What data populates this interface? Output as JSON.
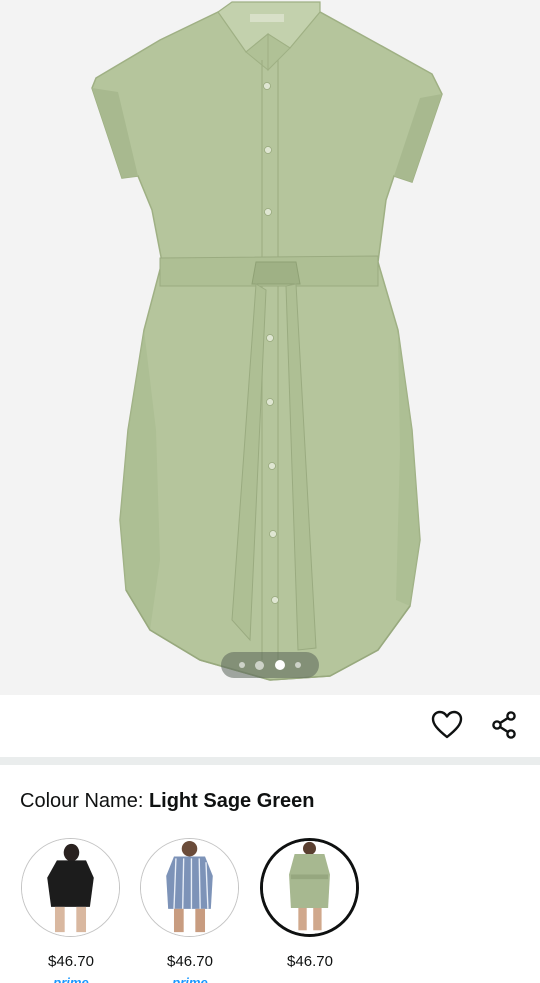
{
  "product": {
    "image_pager": {
      "count": 4,
      "active_index": 2
    }
  },
  "actions": {
    "wishlist_icon": "heart-icon",
    "share_icon": "share-icon"
  },
  "colour": {
    "label": "Colour Name: ",
    "value": "Light Sage Green"
  },
  "swatches": [
    {
      "name": "black",
      "price": "$46.70",
      "prime": "prime",
      "color": "#1c1c1c",
      "selected": false
    },
    {
      "name": "blue-stripe",
      "price": "$46.70",
      "prime": "prime",
      "color": "#7d93b8",
      "selected": false
    },
    {
      "name": "light-sage-green",
      "price": "$46.70",
      "prime": "",
      "color": "#a7b890",
      "selected": true
    }
  ],
  "colors": {
    "dress": "#b5c59c",
    "dress_shade": "#a2b387",
    "background": "#f3f3f3",
    "prime_blue": "#1a98ff"
  }
}
